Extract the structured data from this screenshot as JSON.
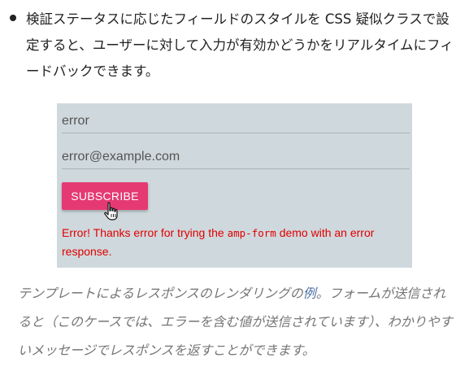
{
  "bullet": {
    "text": "検証ステータスに応じたフィールドのスタイルを CSS 疑似クラスで設定すると、ユーザーに対して入力が有効かどうかをリアルタイムにフィードバックできます。"
  },
  "form": {
    "name_value": "error",
    "email_value": "error@example.com",
    "subscribe_label": "SUBSCRIBE",
    "error_before": "Error! Thanks error for trying the ",
    "error_code": "amp-form",
    "error_after": " demo with an error response."
  },
  "caption": {
    "part1": "テンプレートによるレスポンスのレンダリングの",
    "link": "例",
    "part2": "。フォームが送信されると（このケースでは、エラーを含む値が送信されています）、わかりやすいメッセージでレスポンスを返すことができます。"
  },
  "colors": {
    "panel_bg": "#cfd8dc",
    "button_bg": "#e53973",
    "error_text": "#e00000",
    "link": "#4a6fa5"
  },
  "icons": [
    "hand-pointer-cursor-icon"
  ]
}
